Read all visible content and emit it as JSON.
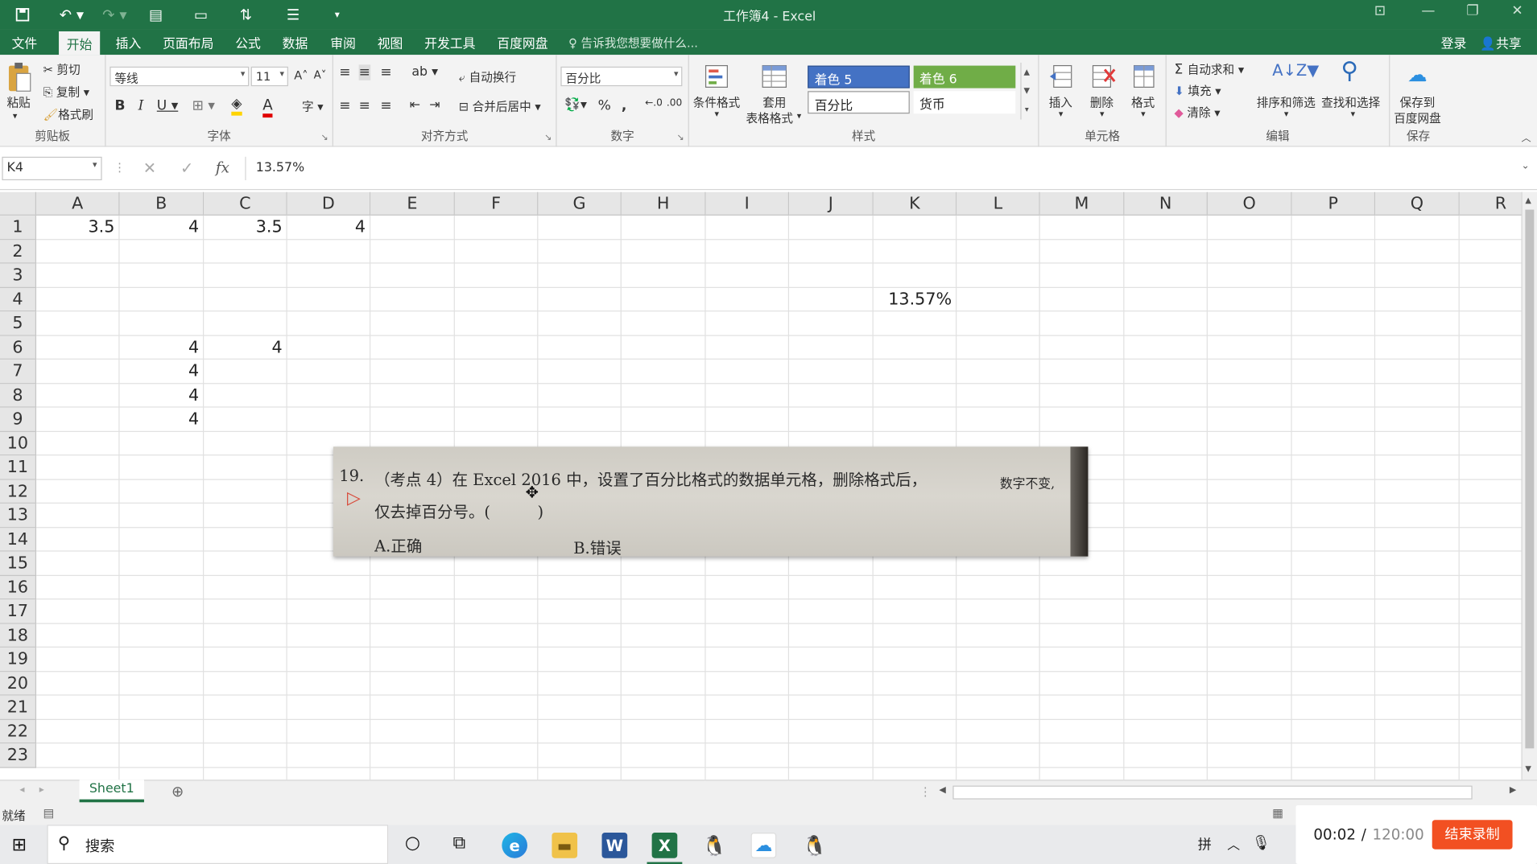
{
  "window": {
    "title": "工作簿4 - Excel"
  },
  "menu": {
    "items": [
      "文件",
      "开始",
      "插入",
      "页面布局",
      "公式",
      "数据",
      "审阅",
      "视图",
      "开发工具",
      "百度网盘"
    ],
    "tell_me": "告诉我您想要做什么...",
    "login": "登录",
    "share": "共享"
  },
  "ribbon": {
    "clipboard": {
      "paste": "粘贴",
      "cut": "剪切",
      "copy": "复制",
      "format_painter": "格式刷",
      "label": "剪贴板"
    },
    "font": {
      "name": "等线",
      "size": "11",
      "label": "字体"
    },
    "alignment": {
      "wrap": "自动换行",
      "merge": "合并后居中",
      "label": "对齐方式"
    },
    "number": {
      "format": "百分比",
      "label": "数字"
    },
    "styles": {
      "conditional": "条件格式",
      "table_line1": "套用",
      "table_line2": "表格格式",
      "accent5": "着色 5",
      "accent6": "着色 6",
      "percent": "百分比",
      "currency": "货币",
      "label": "样式"
    },
    "cells": {
      "insert": "插入",
      "delete": "删除",
      "format": "格式",
      "label": "单元格"
    },
    "editing": {
      "autosum": "自动求和",
      "fill": "填充",
      "clear": "清除",
      "sort": "排序和筛选",
      "find": "查找和选择",
      "label": "编辑"
    },
    "save": {
      "line1": "保存到",
      "line2": "百度网盘",
      "label": "保存"
    }
  },
  "formula_bar": {
    "name_box": "K4",
    "formula": "13.57%"
  },
  "columns": [
    "A",
    "B",
    "C",
    "D",
    "E",
    "F",
    "G",
    "H",
    "I",
    "J",
    "K",
    "L",
    "M",
    "N",
    "O",
    "P",
    "Q",
    "R"
  ],
  "rows": [
    "1",
    "2",
    "3",
    "4",
    "5",
    "6",
    "7",
    "8",
    "9",
    "10",
    "11",
    "12",
    "13",
    "14",
    "15",
    "16",
    "17",
    "18",
    "19",
    "20",
    "21",
    "22",
    "23"
  ],
  "cells": {
    "A1": "3.5",
    "B1": "4",
    "C1": "3.5",
    "D1": "4",
    "K4": "13.57%",
    "B6": "4",
    "C6": "4",
    "B7": "4",
    "B8": "4",
    "B9": "4"
  },
  "photo": {
    "line1_number": "19.",
    "line1_text": "（考点 4）在  Excel 2016  中，设置了百分比格式的数据单元格，删除格式后，",
    "line1_tail": "数字不变,",
    "line2": "仅去掉百分号。(　　　)",
    "option_a": "A.正确",
    "option_b": "B.错误"
  },
  "sheet": {
    "tab": "Sheet1"
  },
  "status": {
    "ready": "就绪"
  },
  "taskbar": {
    "search": "搜索",
    "ime": "拼",
    "timer_elapsed": "00:02",
    "timer_sep": " / ",
    "timer_total": "120:00",
    "end_record": "结束录制"
  },
  "colors": {
    "excel_green": "#217346",
    "accent5": "#4472c4",
    "accent6": "#70ad47",
    "record_red": "#f25022"
  }
}
